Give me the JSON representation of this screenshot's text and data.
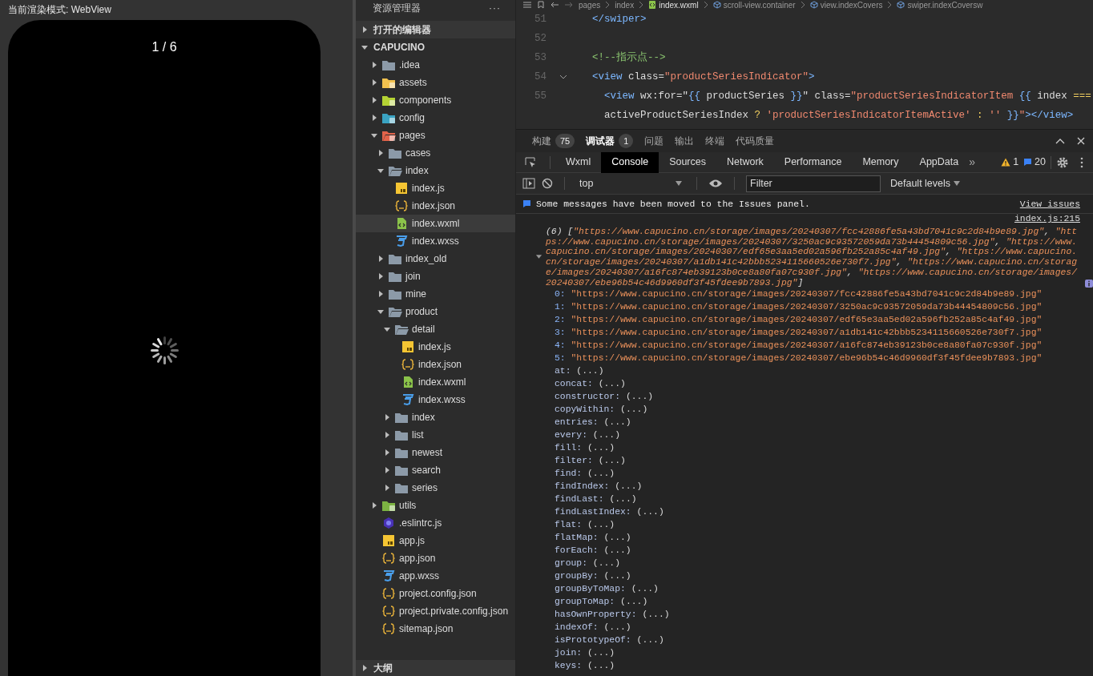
{
  "simulator": {
    "title": "当前渲染模式: WebView",
    "counter": "1 / 6"
  },
  "explorer": {
    "title": "资源管理器",
    "more": "···",
    "sections": [
      {
        "label": "打开的编辑器",
        "expanded": false
      },
      {
        "label": "CAPUCINO",
        "expanded": true
      }
    ],
    "items": [
      {
        "name": ".idea",
        "kind": "folder",
        "expanded": false,
        "selected": false
      },
      {
        "name": "assets",
        "kind": "assets",
        "expanded": false,
        "selected": false
      },
      {
        "name": "components",
        "kind": "components",
        "expanded": false,
        "selected": false
      },
      {
        "name": "config",
        "kind": "config",
        "expanded": false,
        "selected": false
      },
      {
        "name": "pages",
        "kind": "pages",
        "expanded": true,
        "selected": false,
        "children": [
          {
            "name": "cases",
            "kind": "folder",
            "expanded": false,
            "selected": false
          },
          {
            "name": "index",
            "kind": "folder",
            "expanded": true,
            "selected": false,
            "children": [
              {
                "name": "index.js",
                "kind": "js",
                "selected": false
              },
              {
                "name": "index.json",
                "kind": "json",
                "selected": false
              },
              {
                "name": "index.wxml",
                "kind": "wxml",
                "selected": true
              },
              {
                "name": "index.wxss",
                "kind": "wxss",
                "selected": false
              }
            ]
          },
          {
            "name": "index_old",
            "kind": "folder",
            "expanded": false,
            "selected": false
          },
          {
            "name": "join",
            "kind": "folder",
            "expanded": false,
            "selected": false
          },
          {
            "name": "mine",
            "kind": "folder",
            "expanded": false,
            "selected": false
          },
          {
            "name": "product",
            "kind": "folder",
            "expanded": true,
            "selected": false,
            "children": [
              {
                "name": "detail",
                "kind": "folder",
                "expanded": true,
                "selected": false,
                "children": [
                  {
                    "name": "index.js",
                    "kind": "js",
                    "selected": false
                  },
                  {
                    "name": "index.json",
                    "kind": "json",
                    "selected": false
                  },
                  {
                    "name": "index.wxml",
                    "kind": "wxml",
                    "selected": false
                  },
                  {
                    "name": "index.wxss",
                    "kind": "wxss",
                    "selected": false
                  }
                ]
              },
              {
                "name": "index",
                "kind": "folder",
                "expanded": false,
                "selected": false
              },
              {
                "name": "list",
                "kind": "folder",
                "expanded": false,
                "selected": false
              },
              {
                "name": "newest",
                "kind": "folder",
                "expanded": false,
                "selected": false
              },
              {
                "name": "search",
                "kind": "folder",
                "expanded": false,
                "selected": false
              },
              {
                "name": "series",
                "kind": "folder",
                "expanded": false,
                "selected": false
              }
            ]
          }
        ]
      },
      {
        "name": "utils",
        "kind": "utils",
        "expanded": false,
        "selected": false
      },
      {
        "name": ".eslintrc.js",
        "kind": "eslint",
        "selected": false
      },
      {
        "name": "app.js",
        "kind": "js",
        "selected": false
      },
      {
        "name": "app.json",
        "kind": "json",
        "selected": false
      },
      {
        "name": "app.wxss",
        "kind": "wxss",
        "selected": false
      },
      {
        "name": "project.config.json",
        "kind": "json",
        "selected": false
      },
      {
        "name": "project.private.config.json",
        "kind": "json",
        "selected": false
      },
      {
        "name": "sitemap.json",
        "kind": "json",
        "selected": false
      }
    ],
    "outline": {
      "label": "大纲",
      "expanded": false
    }
  },
  "editor": {
    "breadcrumb": [
      {
        "label": "pages",
        "kind": "folder"
      },
      {
        "label": "index",
        "kind": "folder"
      },
      {
        "label": "index.wxml",
        "kind": "file"
      },
      {
        "label": "scroll-view.container",
        "kind": "element"
      },
      {
        "label": "view.indexCovers",
        "kind": "element"
      },
      {
        "label": "swiper.indexCoversw",
        "kind": "element"
      }
    ],
    "lines": [
      {
        "number": "51",
        "foldable": false,
        "tokens": [
          {
            "t": "  </swiper>",
            "kind": "tag"
          }
        ]
      },
      {
        "number": "52",
        "foldable": false
      },
      {
        "number": "53",
        "foldable": false,
        "tokens": [
          {
            "t": "  <!--指示点-->",
            "kind": "comment"
          }
        ]
      },
      {
        "number": "54",
        "foldable": true,
        "tokens": [
          {
            "t": "  <view",
            "kind": "tag"
          },
          {
            "t": " class=",
            "kind": "attr"
          },
          {
            "t": "\"productSeriesIndicator\"",
            "kind": "str"
          },
          {
            "t": ">",
            "kind": "tag"
          }
        ]
      },
      {
        "number": "55",
        "foldable": false,
        "tokens": [
          {
            "t": "    <view",
            "kind": "tag"
          },
          {
            "t": " wx:for=\"",
            "kind": "attr"
          },
          {
            "t": "{{",
            "kind": "tag"
          },
          {
            "t": " productSeries ",
            "kind": "attr"
          },
          {
            "t": "}}",
            "kind": "tag"
          },
          {
            "t": "\" class=",
            "kind": "attr"
          },
          {
            "t": "\"productSeriesIndicatorItem ",
            "kind": "str"
          },
          {
            "t": "{{",
            "kind": "tag"
          },
          {
            "t": " index ",
            "kind": "attr"
          },
          {
            "t": "===",
            "kind": "op"
          }
        ]
      },
      {
        "foldable": false,
        "tokens": [
          {
            "t": "    activeProductSeriesIndex ",
            "kind": "attr"
          },
          {
            "t": "? ",
            "kind": "op"
          },
          {
            "t": "'productSeriesIndicatorItemActive'",
            "kind": "str"
          },
          {
            "t": " : ",
            "kind": "op"
          },
          {
            "t": "''",
            "kind": "str"
          },
          {
            "t": " }}",
            "kind": "tag"
          },
          {
            "t": "\"",
            "kind": "str"
          },
          {
            "t": "></view>",
            "kind": "tag"
          }
        ]
      }
    ]
  },
  "panel_tabs": [
    {
      "label": "构建",
      "count": "75",
      "selected": false
    },
    {
      "label": "调试器",
      "count": "1",
      "selected": true
    },
    {
      "label": "问题",
      "selected": false
    },
    {
      "label": "输出",
      "selected": false
    },
    {
      "label": "终端",
      "selected": false
    },
    {
      "label": "代码质量",
      "selected": false
    }
  ],
  "devtools": {
    "tabs": [
      {
        "label": "Wxml",
        "selected": false
      },
      {
        "label": "Console",
        "selected": true
      },
      {
        "label": "Sources",
        "selected": false
      },
      {
        "label": "Network",
        "selected": false
      },
      {
        "label": "Performance",
        "selected": false
      },
      {
        "label": "Memory",
        "selected": false
      },
      {
        "label": "AppData",
        "selected": false
      }
    ],
    "more": "»",
    "warnings": "1",
    "messages": "20",
    "context": "top",
    "filter_placeholder": "Filter",
    "levels": "Default levels"
  },
  "console": {
    "notice": {
      "text": "Some messages have been moved to the Issues panel.",
      "link": "View issues"
    },
    "log": {
      "source": "index.js:215",
      "expanded": true,
      "count": "(6)",
      "preview": "[\"https://www.capucino.cn/storage/images/20240307/fcc42886fe5a43bd7041c9c2d84b9e89.jpg\", \"https://www.capucino.cn/storage/images/20240307/3250ac9c93572059da73b44454809c56.jpg\", \"https://www.capucino.cn/storage/images/20240307/edf65e3aa5ed02a596fb252a85c4af49.jpg\", \"https://www.capucino.cn/storage/images/20240307/a1db141c42bbb5234115660526e730f7.jpg\", \"https://www.capucino.cn/storage/images/20240307/a16fc874eb39123b0ce8a80fa07c930f.jpg\", \"https://www.capucino.cn/storage/images/20240307/ebe96b54c46d9960df3f45fdee9b7893.jpg\"]",
      "entries": [
        {
          "key": "0:",
          "value": "\"https://www.capucino.cn/storage/images/20240307/fcc42886fe5a43bd7041c9c2d84b9e89.jpg\""
        },
        {
          "key": "1:",
          "value": "\"https://www.capucino.cn/storage/images/20240307/3250ac9c93572059da73b44454809c56.jpg\""
        },
        {
          "key": "2:",
          "value": "\"https://www.capucino.cn/storage/images/20240307/edf65e3aa5ed02a596fb252a85c4af49.jpg\""
        },
        {
          "key": "3:",
          "value": "\"https://www.capucino.cn/storage/images/20240307/a1db141c42bbb5234115660526e730f7.jpg\""
        },
        {
          "key": "4:",
          "value": "\"https://www.capucino.cn/storage/images/20240307/a16fc874eb39123b0ce8a80fa07c930f.jpg\""
        },
        {
          "key": "5:",
          "value": "\"https://www.capucino.cn/storage/images/20240307/ebe96b54c46d9960df3f45fdee9b7893.jpg\""
        }
      ],
      "properties": [
        {
          "key": "at:",
          "value": "(...)"
        },
        {
          "key": "concat:",
          "value": "(...)"
        },
        {
          "key": "constructor:",
          "value": "(...)"
        },
        {
          "key": "copyWithin:",
          "value": "(...)"
        },
        {
          "key": "entries:",
          "value": "(...)"
        },
        {
          "key": "every:",
          "value": "(...)"
        },
        {
          "key": "fill:",
          "value": "(...)"
        },
        {
          "key": "filter:",
          "value": "(...)"
        },
        {
          "key": "find:",
          "value": "(...)"
        },
        {
          "key": "findIndex:",
          "value": "(...)"
        },
        {
          "key": "findLast:",
          "value": "(...)"
        },
        {
          "key": "findLastIndex:",
          "value": "(...)"
        },
        {
          "key": "flat:",
          "value": "(...)"
        },
        {
          "key": "flatMap:",
          "value": "(...)"
        },
        {
          "key": "forEach:",
          "value": "(...)"
        },
        {
          "key": "group:",
          "value": "(...)"
        },
        {
          "key": "groupBy:",
          "value": "(...)"
        },
        {
          "key": "groupByToMap:",
          "value": "(...)"
        },
        {
          "key": "groupToMap:",
          "value": "(...)"
        },
        {
          "key": "hasOwnProperty:",
          "value": "(...)"
        },
        {
          "key": "indexOf:",
          "value": "(...)"
        },
        {
          "key": "isPrototypeOf:",
          "value": "(...)"
        },
        {
          "key": "join:",
          "value": "(...)"
        },
        {
          "key": "keys:",
          "value": "(...)"
        }
      ]
    }
  }
}
